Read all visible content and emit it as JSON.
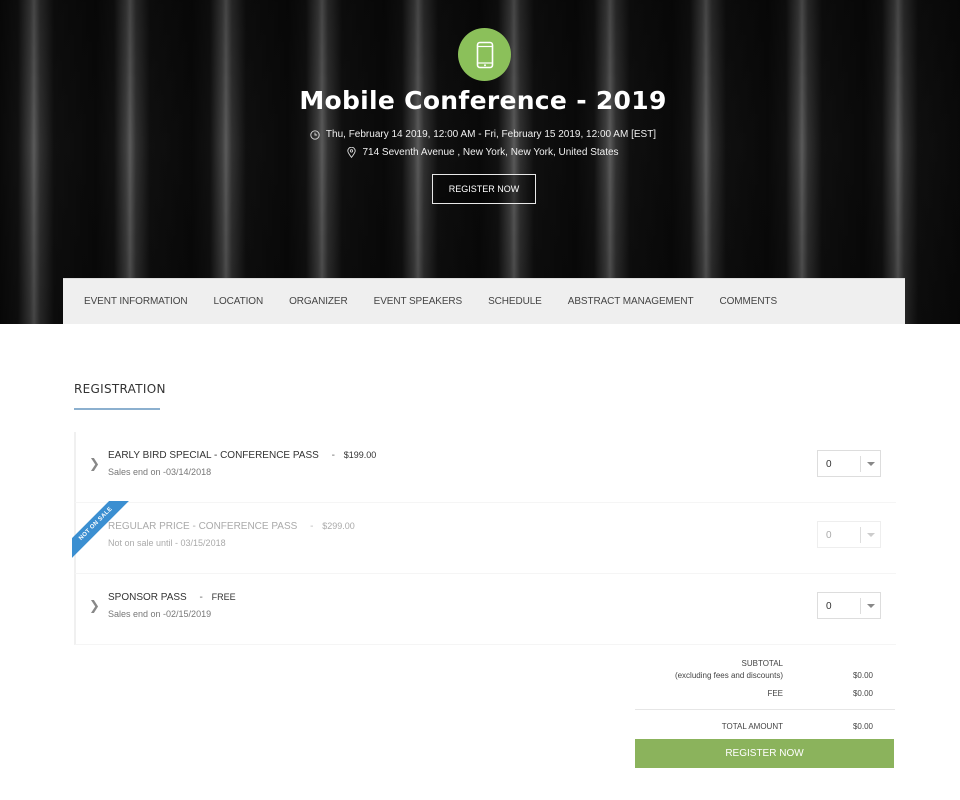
{
  "hero": {
    "title": "Mobile Conference - 2019",
    "date": "Thu, February 14 2019, 12:00 AM - Fri, February 15 2019, 12:00 AM [EST]",
    "location": "714 Seventh Avenue , New York, New York, United States",
    "register_label": "REGISTER NOW",
    "badge_icon": "mobile-phone-icon",
    "badge_color": "#8bc05a"
  },
  "nav": {
    "items": [
      {
        "label": "EVENT INFORMATION"
      },
      {
        "label": "LOCATION"
      },
      {
        "label": "ORGANIZER"
      },
      {
        "label": "EVENT SPEAKERS"
      },
      {
        "label": "SCHEDULE"
      },
      {
        "label": "ABSTRACT MANAGEMENT"
      },
      {
        "label": "COMMENTS"
      }
    ]
  },
  "registration": {
    "title": "REGISTRATION",
    "tickets": [
      {
        "name": "EARLY BIRD SPECIAL - CONFERENCE PASS",
        "separator": "-",
        "price": "$199.00",
        "sub": "Sales end on -03/14/2018",
        "qty": "0"
      },
      {
        "name": "REGULAR PRICE - CONFERENCE PASS",
        "separator": "-",
        "price": "$299.00",
        "sub": "Not on sale until - 03/15/2018",
        "qty": "0",
        "ribbon": "NOT ON SALE"
      },
      {
        "name": "SPONSOR PASS",
        "separator": "-",
        "price": "FREE",
        "sub": "Sales end on -02/15/2019",
        "qty": "0"
      }
    ]
  },
  "summary": {
    "subtotal_label": "SUBTOTAL",
    "subtotal_note": "(excluding fees and discounts)",
    "subtotal_value": "$0.00",
    "fee_label": "FEE",
    "fee_value": "$0.00",
    "total_label": "TOTAL AMOUNT",
    "total_value": "$0.00",
    "register_label": "REGISTER NOW",
    "register_color": "#8bb35c"
  }
}
